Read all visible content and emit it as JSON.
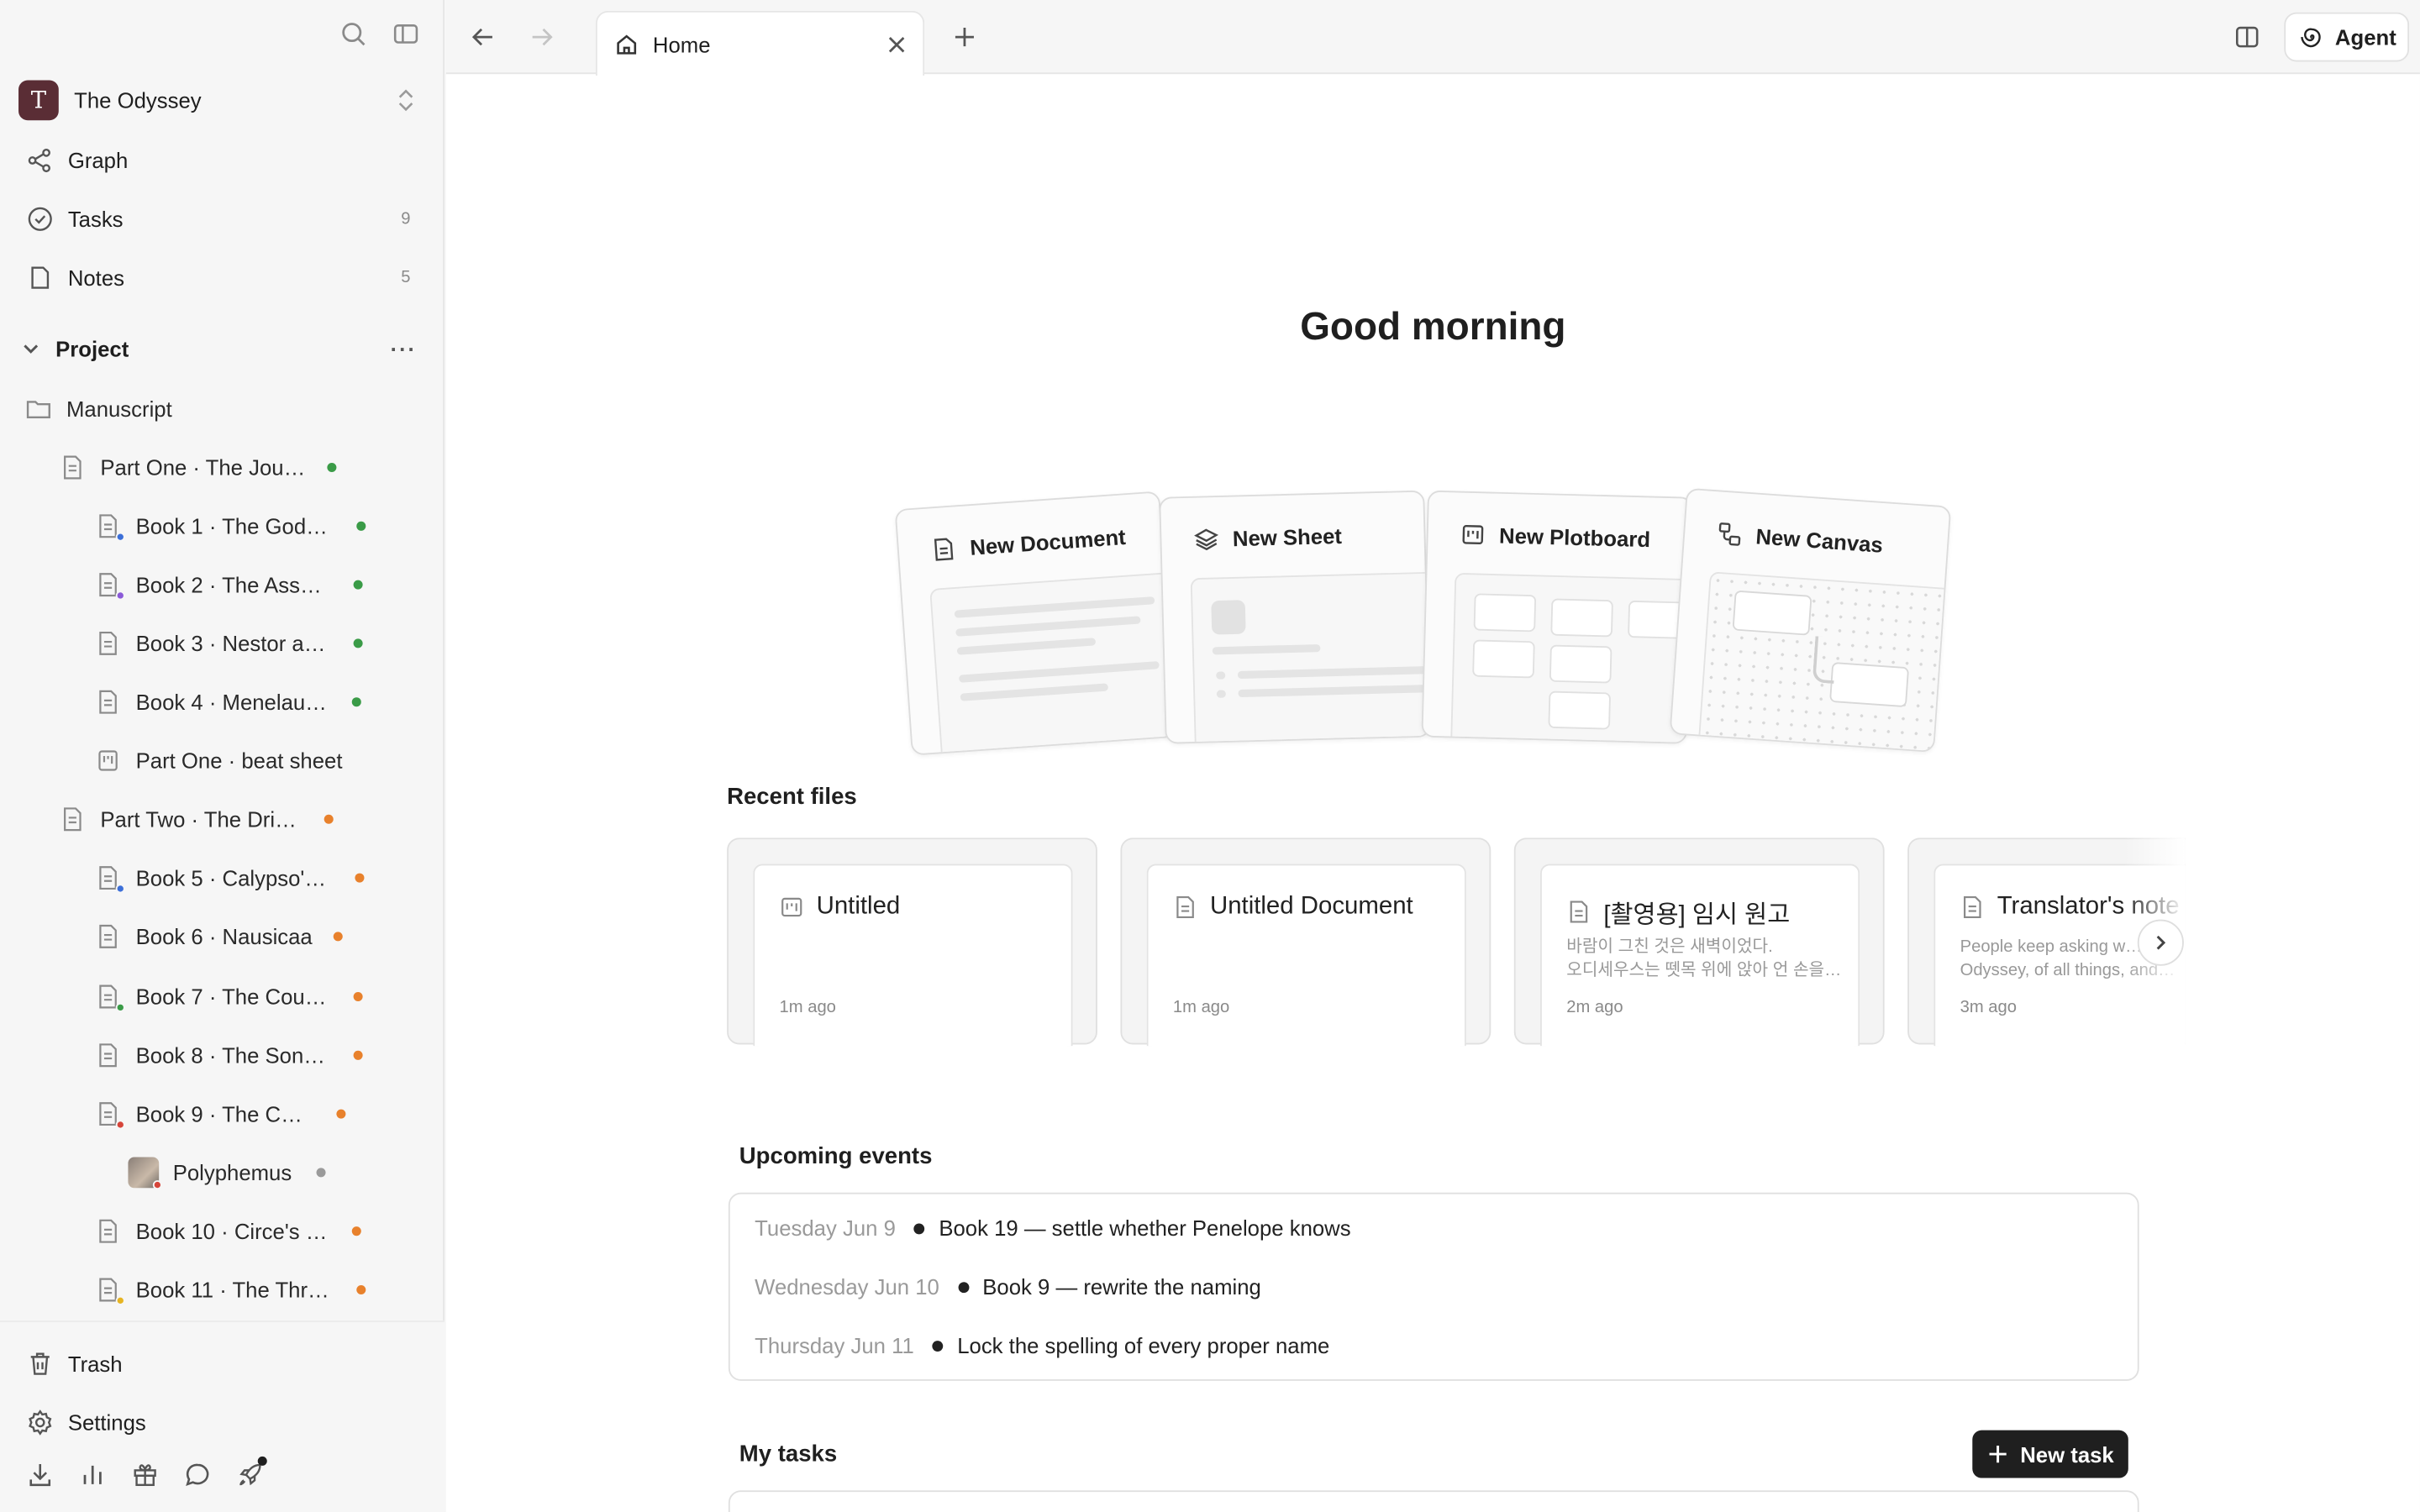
{
  "workspace": {
    "initial": "T",
    "name": "The Odyssey"
  },
  "nav": [
    {
      "label": "Graph",
      "count": ""
    },
    {
      "label": "Tasks",
      "count": "9"
    },
    {
      "label": "Notes",
      "count": "5"
    }
  ],
  "project": {
    "label": "Project"
  },
  "tree": [
    {
      "label": "Manuscript"
    },
    {
      "label": "Part One · The Jou…"
    },
    {
      "label": "Book 1 · The God…"
    },
    {
      "label": "Book 2 · The Ass…"
    },
    {
      "label": "Book 3 · Nestor a…"
    },
    {
      "label": "Book 4 · Menelau…"
    },
    {
      "label": "Part One · beat sheet"
    },
    {
      "label": "Part Two · The Dri…"
    },
    {
      "label": "Book 5 · Calypso'…"
    },
    {
      "label": "Book 6 · Nausicaa"
    },
    {
      "label": "Book 7 · The Cou…"
    },
    {
      "label": "Book 8 · The Son…"
    },
    {
      "label": "Book 9 · The C…"
    },
    {
      "label": "Polyphemus"
    },
    {
      "label": "Book 10 · Circe's …"
    },
    {
      "label": "Book 11 · The Thr…"
    }
  ],
  "status_colors": {
    "green": "#3a9b47",
    "orange": "#e8812c",
    "gray": "#9a9a9a",
    "blue": "#3c6fd8",
    "purple": "#8b5ad8",
    "red": "#d6453a",
    "yellow": "#e6b422"
  },
  "bottom_nav": [
    {
      "label": "Trash"
    },
    {
      "label": "Settings"
    }
  ],
  "tab": {
    "label": "Home"
  },
  "agent": {
    "label": "Agent"
  },
  "greeting": "Good morning",
  "templates": [
    {
      "label": "New Document",
      "icon": "document-icon"
    },
    {
      "label": "New Sheet",
      "icon": "layers-icon"
    },
    {
      "label": "New Plotboard",
      "icon": "board-icon"
    },
    {
      "label": "New Canvas",
      "icon": "canvas-icon"
    }
  ],
  "recent_files": {
    "title": "Recent files",
    "items": [
      {
        "title": "Untitled",
        "preview": "",
        "time": "1m ago"
      },
      {
        "title": "Untitled Document",
        "preview": "",
        "time": "1m ago"
      },
      {
        "title": "[촬영용] 임시 원고",
        "preview": "바람이 그친 것은 새벽이었다.\n오디세우스는 뗏목 위에 앉아 언 손을…",
        "time": "2m ago"
      },
      {
        "title": "Translator's note",
        "preview": "People keep asking w…\nOdyssey, of all things, and…",
        "time": "3m ago"
      }
    ]
  },
  "events": {
    "title": "Upcoming events",
    "items": [
      {
        "date": "Tuesday Jun 9",
        "text": "Book 19 — settle whether Penelope knows"
      },
      {
        "date": "Wednesday Jun 10",
        "text": "Book 9 — rewrite the naming"
      },
      {
        "date": "Thursday Jun 11",
        "text": "Lock the spelling of every proper name"
      }
    ]
  },
  "tasks": {
    "title": "My tasks",
    "new_task_label": "New task"
  }
}
